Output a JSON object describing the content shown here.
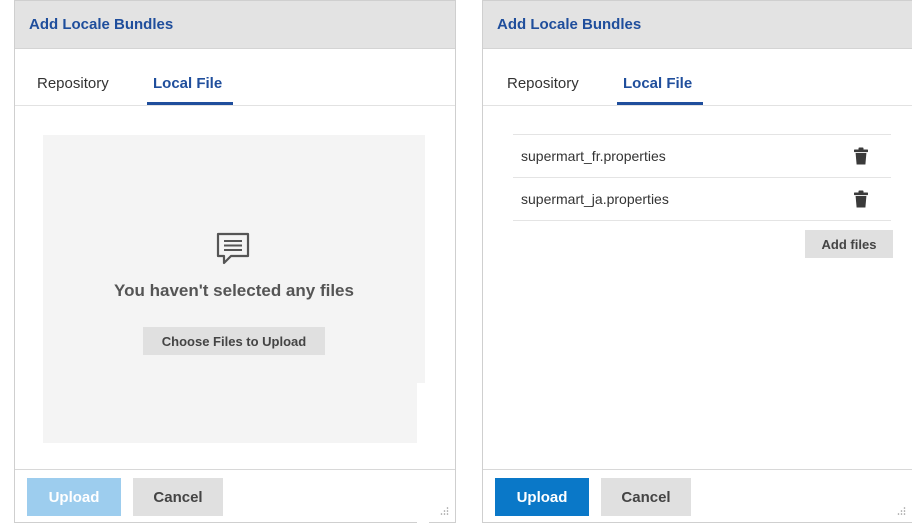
{
  "left_dialog": {
    "title": "Add Locale Bundles",
    "tabs": [
      {
        "label": "Repository"
      },
      {
        "label": "Local File"
      }
    ],
    "active_tab": "Local File",
    "empty_message": "You haven't selected any files",
    "choose_button": "Choose Files to Upload",
    "upload_button": "Upload",
    "upload_state": "disabled",
    "cancel_button": "Cancel"
  },
  "right_dialog": {
    "title": "Add Locale Bundles",
    "tabs": [
      {
        "label": "Repository"
      },
      {
        "label": "Local File"
      }
    ],
    "active_tab": "Local File",
    "files": [
      {
        "name": "supermart_fr.properties"
      },
      {
        "name": "supermart_ja.properties"
      }
    ],
    "add_files_button": "Add files",
    "upload_button": "Upload",
    "upload_state": "enabled",
    "cancel_button": "Cancel"
  },
  "colors": {
    "accent": "#1f4e9c",
    "upload_enabled": "#0a78c8",
    "upload_disabled": "#9dcdee",
    "titlebar": "#e3e3e3"
  },
  "icons": {
    "empty_state": "speech-bubble-icon",
    "delete": "trash-icon",
    "resize": "resize-grip-icon"
  }
}
